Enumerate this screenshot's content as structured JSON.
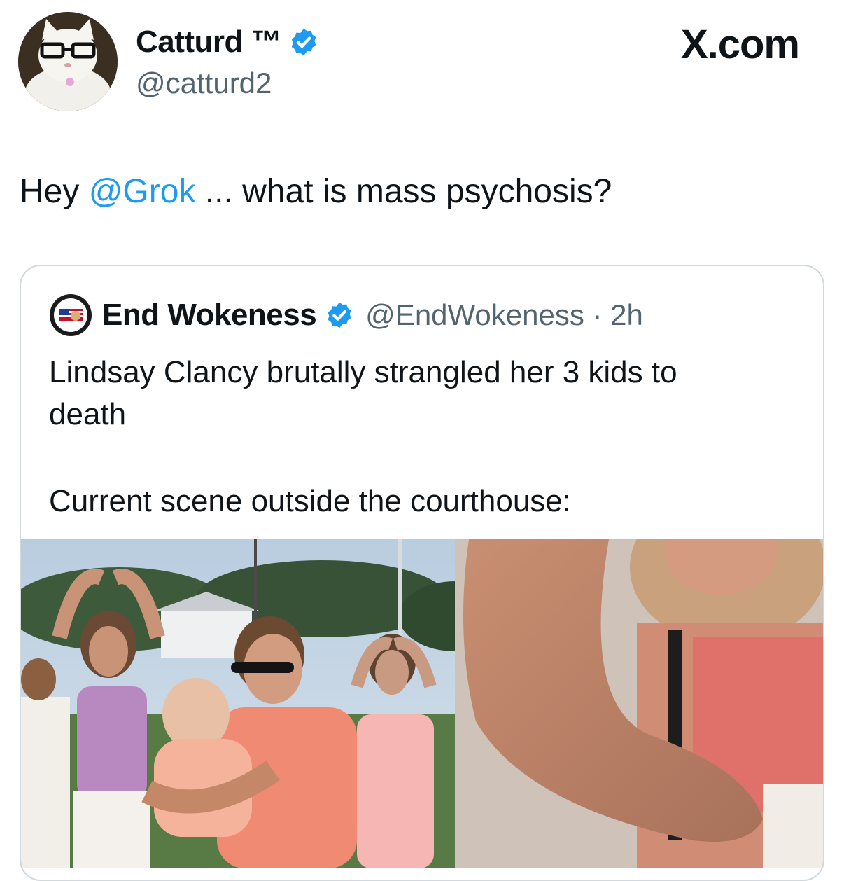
{
  "author": {
    "name": "Catturd ™",
    "handle": "@catturd2",
    "verified": true,
    "avatar_icon": "cat-with-glasses-avatar"
  },
  "brand": "X.com",
  "tweet": {
    "prefix": "Hey ",
    "mention": "@Grok",
    "suffix": " ... what is mass psychosis?"
  },
  "quoted_tweet": {
    "author_name": "End Wokeness",
    "handle_time": "@EndWokeness · 2h",
    "verified": true,
    "avatar_icon": "support-badge-avatar",
    "line1": "Lindsay Clancy brutally strangled her 3 kids to",
    "line2": "death",
    "line3": "Current scene outside the courthouse:",
    "media_icon": "courthouse-crowd-photo"
  },
  "colors": {
    "accent": "#1d9bf0",
    "text": "#0f1419",
    "secondary": "#536471",
    "border": "#cfd9de"
  }
}
